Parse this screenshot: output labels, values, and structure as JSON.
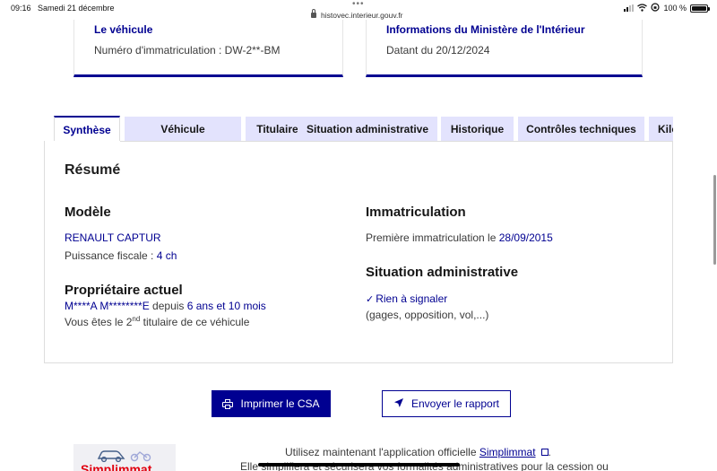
{
  "status_bar": {
    "time": "09:16",
    "date": "Samedi 21 décembre",
    "url": "histovec.interieur.gouv.fr",
    "battery": "100 %"
  },
  "cards": {
    "left": {
      "title": "Le véhicule",
      "text": "Numéro d'immatriculation : DW-2**-BM"
    },
    "right": {
      "title": "Informations du Ministère de l'Intérieur",
      "text": "Datant du 20/12/2024"
    }
  },
  "tabs": [
    {
      "label": "Synthèse",
      "active": true
    },
    {
      "label": "Véhicule"
    },
    {
      "label": "Titulaire et Titre"
    },
    {
      "label": "Situation administrative"
    },
    {
      "label": "Historique"
    },
    {
      "label": "Contrôles techniques"
    },
    {
      "label": "Kilo"
    }
  ],
  "summary": {
    "title": "Résumé",
    "model": {
      "heading": "Modèle",
      "name": "RENAULT CAPTUR",
      "power_label": "Puissance fiscale : ",
      "power_value": "4 ch"
    },
    "owner": {
      "heading": "Propriétaire actuel",
      "name": "M****A M********E",
      "since_label": " depuis ",
      "since_value": "6 ans et 10 mois",
      "rank_prefix": "Vous êtes le ",
      "rank_number": "2",
      "rank_suffix": "nd",
      "rank_rest": " titulaire de ce véhicule"
    },
    "registration": {
      "heading": "Immatriculation",
      "label": "Première immatriculation le ",
      "date": "28/09/2015"
    },
    "admin": {
      "heading": "Situation administrative",
      "status": "Rien à signaler",
      "details": "(gages, opposition, vol,...)"
    }
  },
  "buttons": {
    "print": "Imprimer le CSA",
    "send": "Envoyer le rapport"
  },
  "promo": {
    "brand": "Simplimmat",
    "line1_prefix": "Utilisez maintenant l'application officielle ",
    "link": "Simplimmat",
    "line1_suffix": ".",
    "line2": "Elle simplifiera et sécurisera vos formalités administratives pour la cession ou"
  },
  "colors": {
    "accent": "#000091",
    "tab_bg": "#e3e3fd",
    "brand_red": "#e1000f"
  }
}
